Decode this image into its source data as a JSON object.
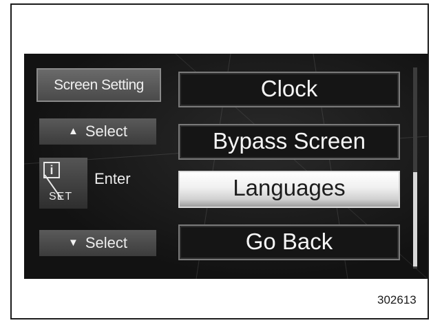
{
  "header": {
    "title": "Screen Setting"
  },
  "controls": {
    "select_up_label": "Select",
    "select_down_label": "Select",
    "info_glyph": "i",
    "set_label": "SET",
    "enter_label": "Enter"
  },
  "menu": {
    "items": [
      {
        "label": "Clock",
        "selected": false
      },
      {
        "label": "Bypass Screen",
        "selected": false
      },
      {
        "label": "Languages",
        "selected": true
      },
      {
        "label": "Go Back",
        "selected": false
      }
    ]
  },
  "scrollbar": {
    "position_fraction": 0.52,
    "visible_fraction": 0.47
  },
  "figure_number": "302613",
  "icons": {
    "up": "up-triangle-icon",
    "down": "down-triangle-icon",
    "info": "info-set-icon"
  },
  "colors": {
    "screen_bg": "#151515",
    "highlight": "#f0f0f0",
    "frame": "#1a1a1a"
  }
}
